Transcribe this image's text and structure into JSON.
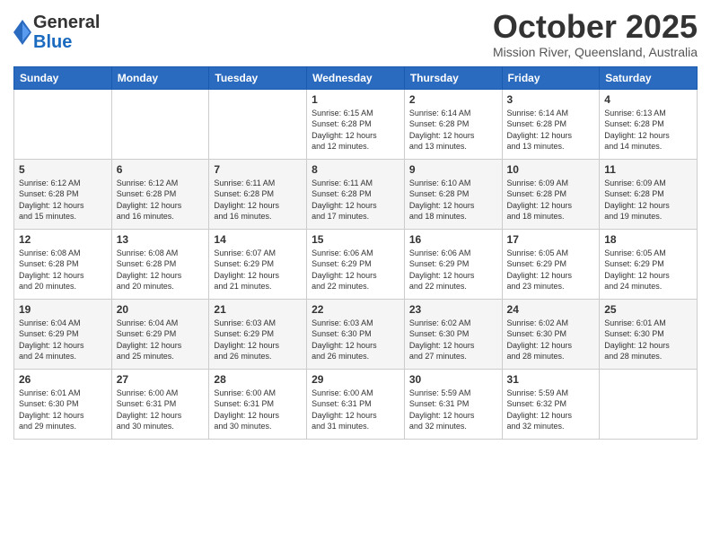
{
  "header": {
    "logo_general": "General",
    "logo_blue": "Blue",
    "month": "October 2025",
    "location": "Mission River, Queensland, Australia"
  },
  "weekdays": [
    "Sunday",
    "Monday",
    "Tuesday",
    "Wednesday",
    "Thursday",
    "Friday",
    "Saturday"
  ],
  "weeks": [
    [
      {
        "day": "",
        "info": ""
      },
      {
        "day": "",
        "info": ""
      },
      {
        "day": "",
        "info": ""
      },
      {
        "day": "1",
        "info": "Sunrise: 6:15 AM\nSunset: 6:28 PM\nDaylight: 12 hours\nand 12 minutes."
      },
      {
        "day": "2",
        "info": "Sunrise: 6:14 AM\nSunset: 6:28 PM\nDaylight: 12 hours\nand 13 minutes."
      },
      {
        "day": "3",
        "info": "Sunrise: 6:14 AM\nSunset: 6:28 PM\nDaylight: 12 hours\nand 13 minutes."
      },
      {
        "day": "4",
        "info": "Sunrise: 6:13 AM\nSunset: 6:28 PM\nDaylight: 12 hours\nand 14 minutes."
      }
    ],
    [
      {
        "day": "5",
        "info": "Sunrise: 6:12 AM\nSunset: 6:28 PM\nDaylight: 12 hours\nand 15 minutes."
      },
      {
        "day": "6",
        "info": "Sunrise: 6:12 AM\nSunset: 6:28 PM\nDaylight: 12 hours\nand 16 minutes."
      },
      {
        "day": "7",
        "info": "Sunrise: 6:11 AM\nSunset: 6:28 PM\nDaylight: 12 hours\nand 16 minutes."
      },
      {
        "day": "8",
        "info": "Sunrise: 6:11 AM\nSunset: 6:28 PM\nDaylight: 12 hours\nand 17 minutes."
      },
      {
        "day": "9",
        "info": "Sunrise: 6:10 AM\nSunset: 6:28 PM\nDaylight: 12 hours\nand 18 minutes."
      },
      {
        "day": "10",
        "info": "Sunrise: 6:09 AM\nSunset: 6:28 PM\nDaylight: 12 hours\nand 18 minutes."
      },
      {
        "day": "11",
        "info": "Sunrise: 6:09 AM\nSunset: 6:28 PM\nDaylight: 12 hours\nand 19 minutes."
      }
    ],
    [
      {
        "day": "12",
        "info": "Sunrise: 6:08 AM\nSunset: 6:28 PM\nDaylight: 12 hours\nand 20 minutes."
      },
      {
        "day": "13",
        "info": "Sunrise: 6:08 AM\nSunset: 6:28 PM\nDaylight: 12 hours\nand 20 minutes."
      },
      {
        "day": "14",
        "info": "Sunrise: 6:07 AM\nSunset: 6:29 PM\nDaylight: 12 hours\nand 21 minutes."
      },
      {
        "day": "15",
        "info": "Sunrise: 6:06 AM\nSunset: 6:29 PM\nDaylight: 12 hours\nand 22 minutes."
      },
      {
        "day": "16",
        "info": "Sunrise: 6:06 AM\nSunset: 6:29 PM\nDaylight: 12 hours\nand 22 minutes."
      },
      {
        "day": "17",
        "info": "Sunrise: 6:05 AM\nSunset: 6:29 PM\nDaylight: 12 hours\nand 23 minutes."
      },
      {
        "day": "18",
        "info": "Sunrise: 6:05 AM\nSunset: 6:29 PM\nDaylight: 12 hours\nand 24 minutes."
      }
    ],
    [
      {
        "day": "19",
        "info": "Sunrise: 6:04 AM\nSunset: 6:29 PM\nDaylight: 12 hours\nand 24 minutes."
      },
      {
        "day": "20",
        "info": "Sunrise: 6:04 AM\nSunset: 6:29 PM\nDaylight: 12 hours\nand 25 minutes."
      },
      {
        "day": "21",
        "info": "Sunrise: 6:03 AM\nSunset: 6:29 PM\nDaylight: 12 hours\nand 26 minutes."
      },
      {
        "day": "22",
        "info": "Sunrise: 6:03 AM\nSunset: 6:30 PM\nDaylight: 12 hours\nand 26 minutes."
      },
      {
        "day": "23",
        "info": "Sunrise: 6:02 AM\nSunset: 6:30 PM\nDaylight: 12 hours\nand 27 minutes."
      },
      {
        "day": "24",
        "info": "Sunrise: 6:02 AM\nSunset: 6:30 PM\nDaylight: 12 hours\nand 28 minutes."
      },
      {
        "day": "25",
        "info": "Sunrise: 6:01 AM\nSunset: 6:30 PM\nDaylight: 12 hours\nand 28 minutes."
      }
    ],
    [
      {
        "day": "26",
        "info": "Sunrise: 6:01 AM\nSunset: 6:30 PM\nDaylight: 12 hours\nand 29 minutes."
      },
      {
        "day": "27",
        "info": "Sunrise: 6:00 AM\nSunset: 6:31 PM\nDaylight: 12 hours\nand 30 minutes."
      },
      {
        "day": "28",
        "info": "Sunrise: 6:00 AM\nSunset: 6:31 PM\nDaylight: 12 hours\nand 30 minutes."
      },
      {
        "day": "29",
        "info": "Sunrise: 6:00 AM\nSunset: 6:31 PM\nDaylight: 12 hours\nand 31 minutes."
      },
      {
        "day": "30",
        "info": "Sunrise: 5:59 AM\nSunset: 6:31 PM\nDaylight: 12 hours\nand 32 minutes."
      },
      {
        "day": "31",
        "info": "Sunrise: 5:59 AM\nSunset: 6:32 PM\nDaylight: 12 hours\nand 32 minutes."
      },
      {
        "day": "",
        "info": ""
      }
    ]
  ]
}
